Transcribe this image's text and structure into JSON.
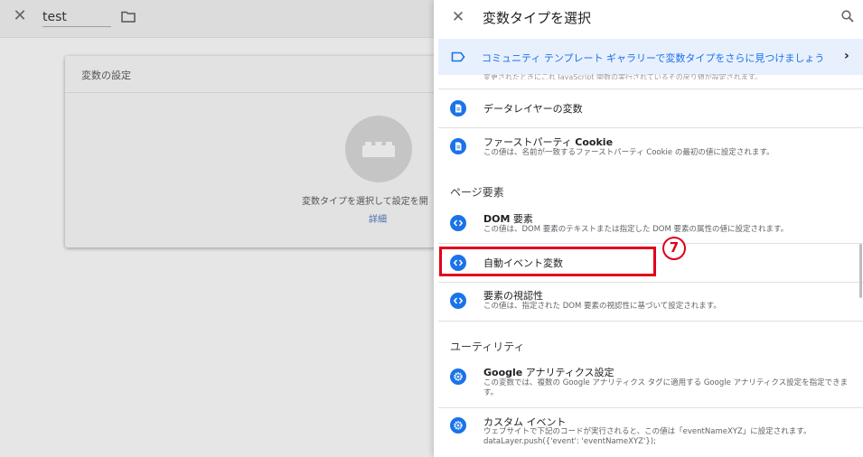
{
  "editor": {
    "variable_name": "test",
    "card_title": "変数の設定",
    "card_hint": "変数タイプを選択して設定を開",
    "card_link": "詳細"
  },
  "panel": {
    "title": "変数タイプを選択",
    "banner_text": "コミュニティ テンプレート ギャラリーで変数タイプをさらに見つけましょう",
    "cut_text": "変更されたときにこれ JavaScript 関数の実行されているその戻り値が設定されます。",
    "items": [
      {
        "title": "データレイヤーの変数",
        "desc": ""
      },
      {
        "title_prefix": "ファーストパーティ ",
        "title_bold": "Cookie",
        "desc": "この値は、名前が一致するファーストパーティ Cookie の最初の値に設定されます。"
      }
    ],
    "sections": {
      "page_elements": "ページ要素",
      "utilities": "ユーティリティ"
    },
    "page_items": [
      {
        "title_bold": "DOM",
        "title_suffix": " 要素",
        "desc": "この値は、DOM 要素のテキストまたは指定した DOM 要素の属性の値に設定されます。"
      },
      {
        "title": "自動イベント変数",
        "desc": ""
      },
      {
        "title": "要素の視認性",
        "desc": "この値は、指定された DOM 要素の視認性に基づいて設定されます。"
      }
    ],
    "utility_items": [
      {
        "title_bold": "Google",
        "title_suffix": " アナリティクス設定",
        "desc": "この変数では、複数の Google アナリティクス タグに適用する Google アナリティクス設定を指定できます。"
      },
      {
        "title": "カスタム イベント",
        "desc": "ウェブサイトで下記のコードが実行されると、この値は「eventNameXYZ」に設定されます。 dataLayer.push({'event': 'eventNameXYZ'});"
      }
    ]
  },
  "annotation": {
    "step": "7"
  },
  "colors": {
    "accent": "#1a73e8",
    "highlight": "#e0001b",
    "banner_bg": "#e8f0fe"
  }
}
